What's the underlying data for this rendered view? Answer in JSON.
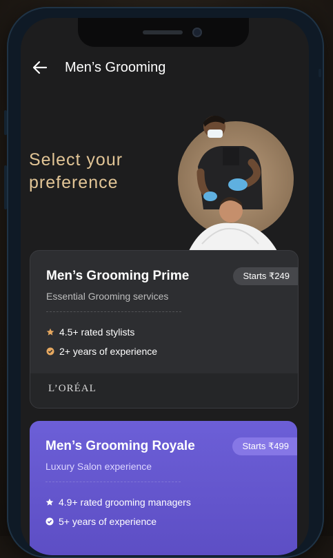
{
  "header": {
    "title": "Men’s Grooming"
  },
  "hero": {
    "line1": "Select your",
    "line2": "preference"
  },
  "cards": [
    {
      "name": "Men’s Grooming Prime",
      "subtitle": "Essential Grooming services",
      "price": "Starts ₹249",
      "features": [
        "4.5+ rated stylists",
        "2+ years of experience"
      ],
      "brand": "L’ORÉAL"
    },
    {
      "name": "Men’s Grooming Royale",
      "subtitle": "Luxury Salon experience",
      "price": "Starts ₹499",
      "features": [
        "4.9+ rated grooming managers",
        "5+ years of experience"
      ]
    }
  ],
  "colors": {
    "accent_gold": "#e2c596",
    "royale_purple": "#6c5fd7",
    "screen_bg": "#1d1d1e"
  },
  "icons": [
    "arrow-left-icon",
    "star-icon",
    "check-badge-icon"
  ]
}
